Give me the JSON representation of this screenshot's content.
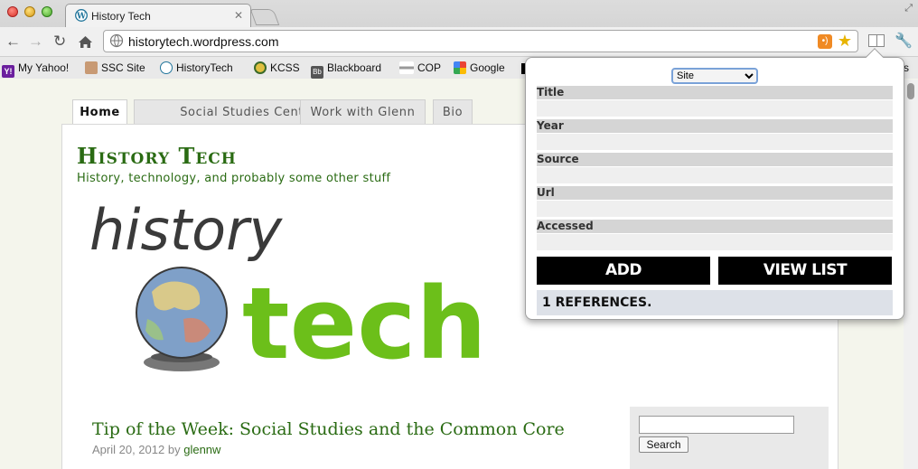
{
  "browser": {
    "tab_title": "History Tech",
    "tab_close": "✕",
    "url": "historytech.wordpress.com",
    "bookmarks": [
      {
        "label": "My Yahoo!",
        "icon": "yahoo-icon",
        "color": "#6b1f9e"
      },
      {
        "label": "SSC Site",
        "icon": "person-icon",
        "color": "#b08060"
      },
      {
        "label": "HistoryTech",
        "icon": "wordpress-icon",
        "color": "#21759b"
      },
      {
        "label": "KCSS",
        "icon": "kcss-icon",
        "color": "#3a6a2a"
      },
      {
        "label": "Blackboard",
        "icon": "blackboard-icon",
        "color": "#555555"
      },
      {
        "label": "COP",
        "icon": "cop-icon",
        "color": "#888888"
      },
      {
        "label": "Google",
        "icon": "google-icon",
        "color": "#4285f4"
      }
    ],
    "bookmark_overflow": "s"
  },
  "site": {
    "nav_tabs": [
      "Home",
      "Social Studies Central",
      "Work with Glenn",
      "Bio"
    ],
    "title": "History Tech",
    "description": "History, technology, and probably some other stuff",
    "logo_word1": "history",
    "logo_word2": "tech",
    "post_title": "Tip of the Week: Social Studies and the Common Core",
    "post_date": "April 20, 2012",
    "post_by": "by",
    "post_author": "glennw",
    "search_button": "Search"
  },
  "popup": {
    "type_select": "Site",
    "fields": [
      "Title",
      "Year",
      "Source",
      "Url",
      "Accessed"
    ],
    "add_button": "ADD",
    "view_list_button": "VIEW LIST",
    "references": "1 REFERENCES."
  },
  "colors": {
    "site_green": "#2a6b13",
    "logo_green": "#6cbf1a"
  }
}
